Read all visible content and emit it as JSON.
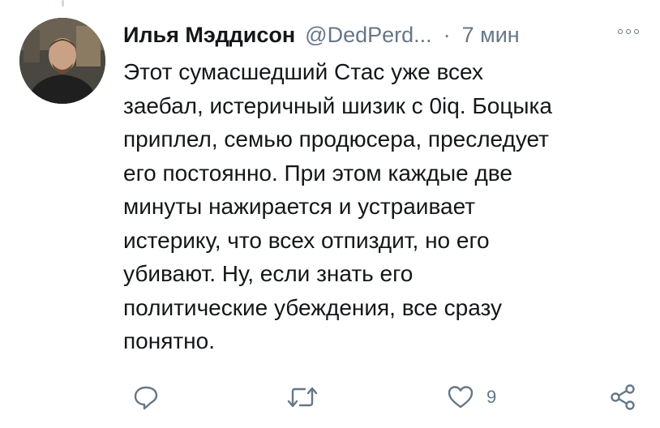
{
  "tweet": {
    "display_name": "Илья Мэддисон",
    "handle": "@DedPerd...",
    "separator": "·",
    "time": "7 мин",
    "text": "Этот сумасшедший Стас уже всех\nзаебал, истеричный шизик с 0iq. Боцыка\nприплел, семью продюсера, преследует\nего постоянно. При этом каждые две\nминуты нажирается и устраивает\nистерику, что всех отпиздит, но его\nубивают. Ну, если знать его\nполитические убеждения, все сразу\nпонятно."
  },
  "actions": {
    "reply_icon": "reply-icon",
    "retweet_icon": "retweet-icon",
    "like_icon": "heart-icon",
    "like_count": "9",
    "share_icon": "share-icon"
  },
  "colors": {
    "text": "#14171a",
    "secondary": "#657786",
    "thread_line": "#cfd9de",
    "background": "#ffffff"
  }
}
